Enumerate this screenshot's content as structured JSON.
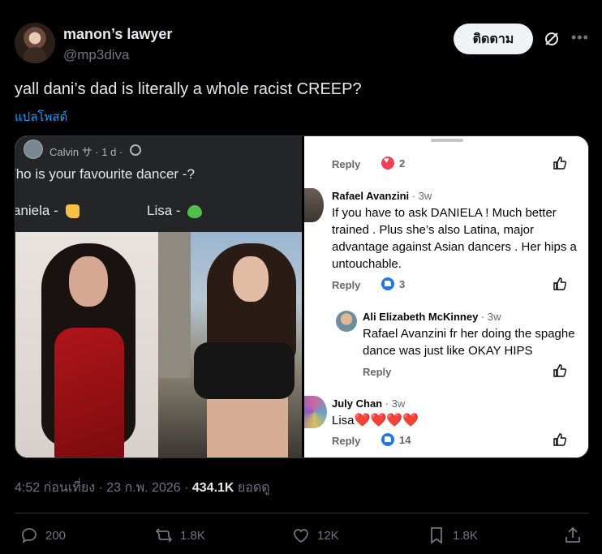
{
  "author": {
    "name": "manon’s lawyer",
    "handle": "@mp3diva",
    "follow_label": "ติดตาม"
  },
  "tweet": {
    "text": "yall dani’s dad is literally a whole racist CREEP?",
    "translate_label": "แปลโพสต์",
    "timestamp": "4:52 ก่อนเที่ยง · 23 ก.พ. 2026 · ",
    "views_count": "434.1K",
    "views_label": " ยอดดู"
  },
  "media": {
    "left_post": {
      "author": "Calvin サ · 1 d ·",
      "question": "/ho is your favourite dancer -?",
      "option_1": "aniela -",
      "option_2": "Lisa -"
    },
    "comments": {
      "top_reply_label": "Reply",
      "top_reaction_count": "2",
      "c1_name": "Rafael Avanzini",
      "c1_time": " · 3w",
      "c1_line1": "If you have to ask DANIELA ! Much better",
      "c1_line2": "trained . Plus she’s also Latina, major",
      "c1_line3": "advantage against Asian dancers . Her hips a",
      "c1_line4": "untouchable.",
      "c1_reply": "Reply",
      "c1_reactions": "3",
      "c2_name": "Ali Elizabeth McKinney",
      "c2_time": " · 3w",
      "c2_line1": "Rafael Avanzini fr her doing the spaghe",
      "c2_line2": "dance was just like OKAY HIPS",
      "c2_reply": "Reply",
      "c3_name": "July Chan",
      "c3_time": " · 3w",
      "c3_text": "Lisa",
      "c3_hearts": "❤️❤️❤️❤️",
      "c3_reply": "Reply",
      "c3_reactions": "14"
    }
  },
  "actions": {
    "replies": "200",
    "reposts": "1.8K",
    "likes": "12K",
    "bookmarks": "1.8K"
  },
  "icons": [
    "grok-icon",
    "more-icon",
    "reply-icon",
    "repost-icon",
    "like-icon",
    "bookmark-icon",
    "share-icon"
  ],
  "colors": {
    "accent": "#1d9bf0",
    "background": "#000000",
    "muted": "#71767b"
  }
}
